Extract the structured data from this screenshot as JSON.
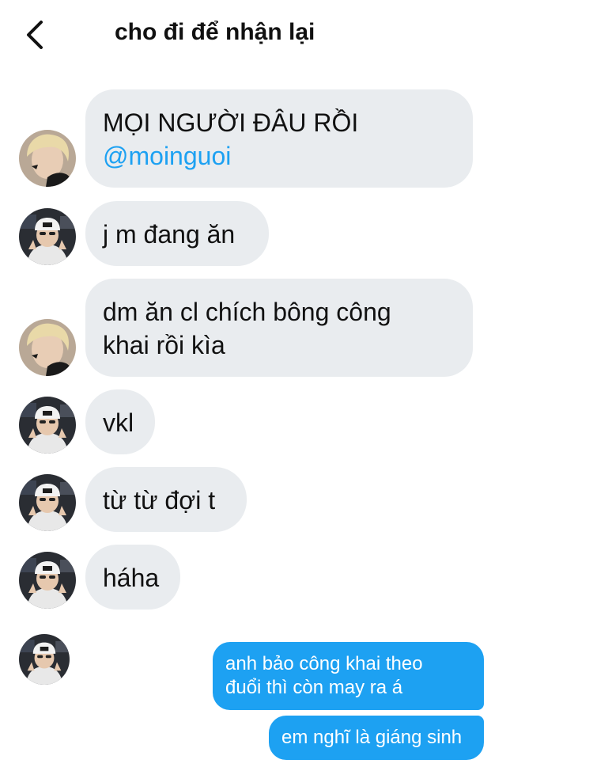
{
  "header": {
    "title": "cho đi để nhận lại",
    "back_icon": "chevron-left-icon"
  },
  "colors": {
    "incoming_bubble": "#e9ecef",
    "outgoing_bubble": "#1da1f2",
    "mention": "#1da1f2"
  },
  "messages": [
    {
      "direction": "incoming",
      "sender": "blonde-user",
      "lines": [
        "MỌI NGƯỜI ĐÂU RỒI"
      ],
      "mention": "@moinguoi"
    },
    {
      "direction": "incoming",
      "sender": "cap-user",
      "lines": [
        "j m đang ăn"
      ]
    },
    {
      "direction": "incoming",
      "sender": "blonde-user",
      "lines": [
        "dm ăn cl chích bông công",
        "khai rồi kìa"
      ]
    },
    {
      "direction": "incoming",
      "sender": "cap-user",
      "lines": [
        "vkl"
      ]
    },
    {
      "direction": "incoming",
      "sender": "cap-user",
      "lines": [
        "từ từ đợi t"
      ]
    },
    {
      "direction": "incoming",
      "sender": "cap-user",
      "lines": [
        "háha"
      ]
    },
    {
      "direction": "outgoing",
      "lines": [
        "anh bảo công khai theo",
        "đuổi thì còn may ra á"
      ]
    },
    {
      "direction": "outgoing",
      "lines": [
        "em nghĩ là giáng sinh"
      ]
    }
  ]
}
